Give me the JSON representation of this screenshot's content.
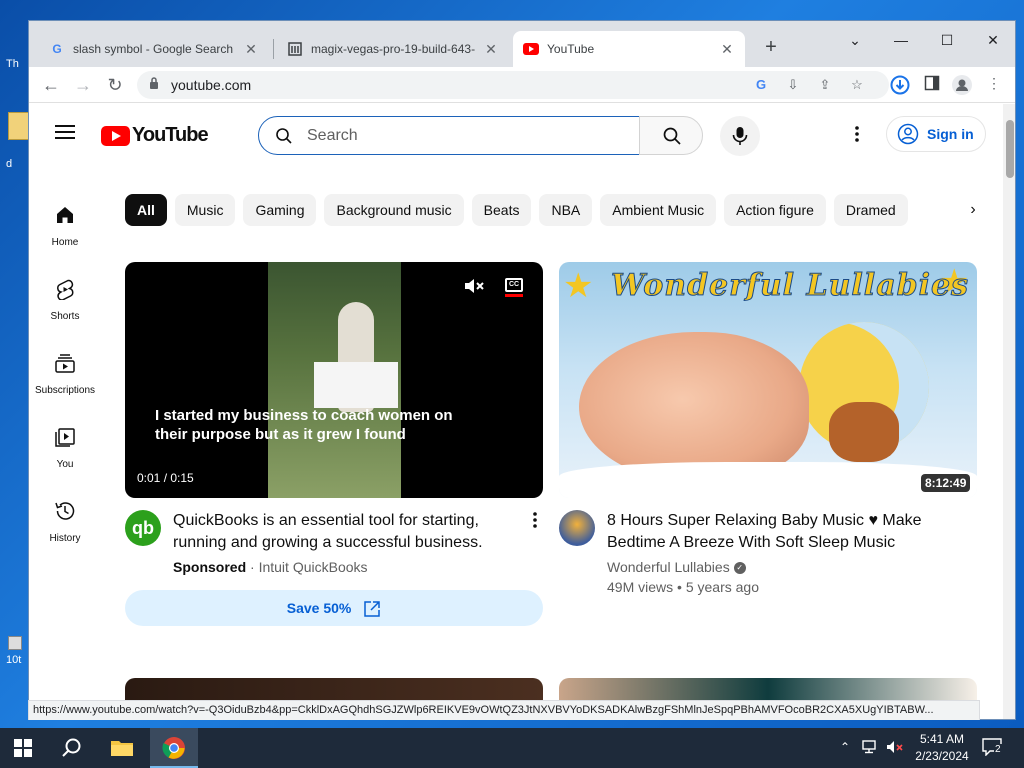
{
  "browser": {
    "tabs": [
      {
        "title": "slash symbol - Google Search",
        "favicon": "google-g-icon"
      },
      {
        "title": "magix-vegas-pro-19-build-643-",
        "favicon": "document-icon"
      },
      {
        "title": "YouTube",
        "favicon": "youtube-icon"
      }
    ],
    "url": "youtube.com",
    "status_url": "https://www.youtube.com/watch?v=-Q3OiduBzb4&pp=CkklDxAGQhdhSGJZWlp6REIKVE9vOWtQZ3JtNXVBVYoDKSADKAlwBzgFShMlnJeSpqPBhAMVFOcoBR2CXA5XUgYIBTABW..."
  },
  "youtube": {
    "logo_text": "YouTube",
    "search_placeholder": "Search",
    "sign_in": "Sign in",
    "sidebar": [
      {
        "label": "Home",
        "icon": "home-icon"
      },
      {
        "label": "Shorts",
        "icon": "shorts-icon"
      },
      {
        "label": "Subscriptions",
        "icon": "subscriptions-icon"
      },
      {
        "label": "You",
        "icon": "you-icon"
      },
      {
        "label": "History",
        "icon": "history-icon"
      }
    ],
    "chips": [
      "All",
      "Music",
      "Gaming",
      "Background music",
      "Beats",
      "NBA",
      "Ambient Music",
      "Action figure",
      "Dramed"
    ],
    "ad": {
      "caption": "I started my business to coach women on their purpose but as it grew I found",
      "time": "0:01 / 0:15",
      "title": "QuickBooks is an essential tool for starting, running and growing a successful business.",
      "sponsored": "Sponsored",
      "advertiser": "Intuit QuickBooks",
      "cta": "Save 50%",
      "avatar_text": "qb"
    },
    "video": {
      "thumb_text": "Wonderful Lullabies",
      "duration": "8:12:49",
      "title": "8 Hours Super Relaxing Baby Music ♥ Make Bedtime A Breeze With Soft Sleep Music",
      "channel": "Wonderful Lullabies",
      "views": "49M views",
      "age": "5 years ago"
    }
  },
  "taskbar": {
    "time": "5:41 AM",
    "date": "2/23/2024",
    "notifications": "2"
  },
  "desktop": {
    "label_top": "Th",
    "label_mid": "d",
    "label_bottom": "10t"
  }
}
